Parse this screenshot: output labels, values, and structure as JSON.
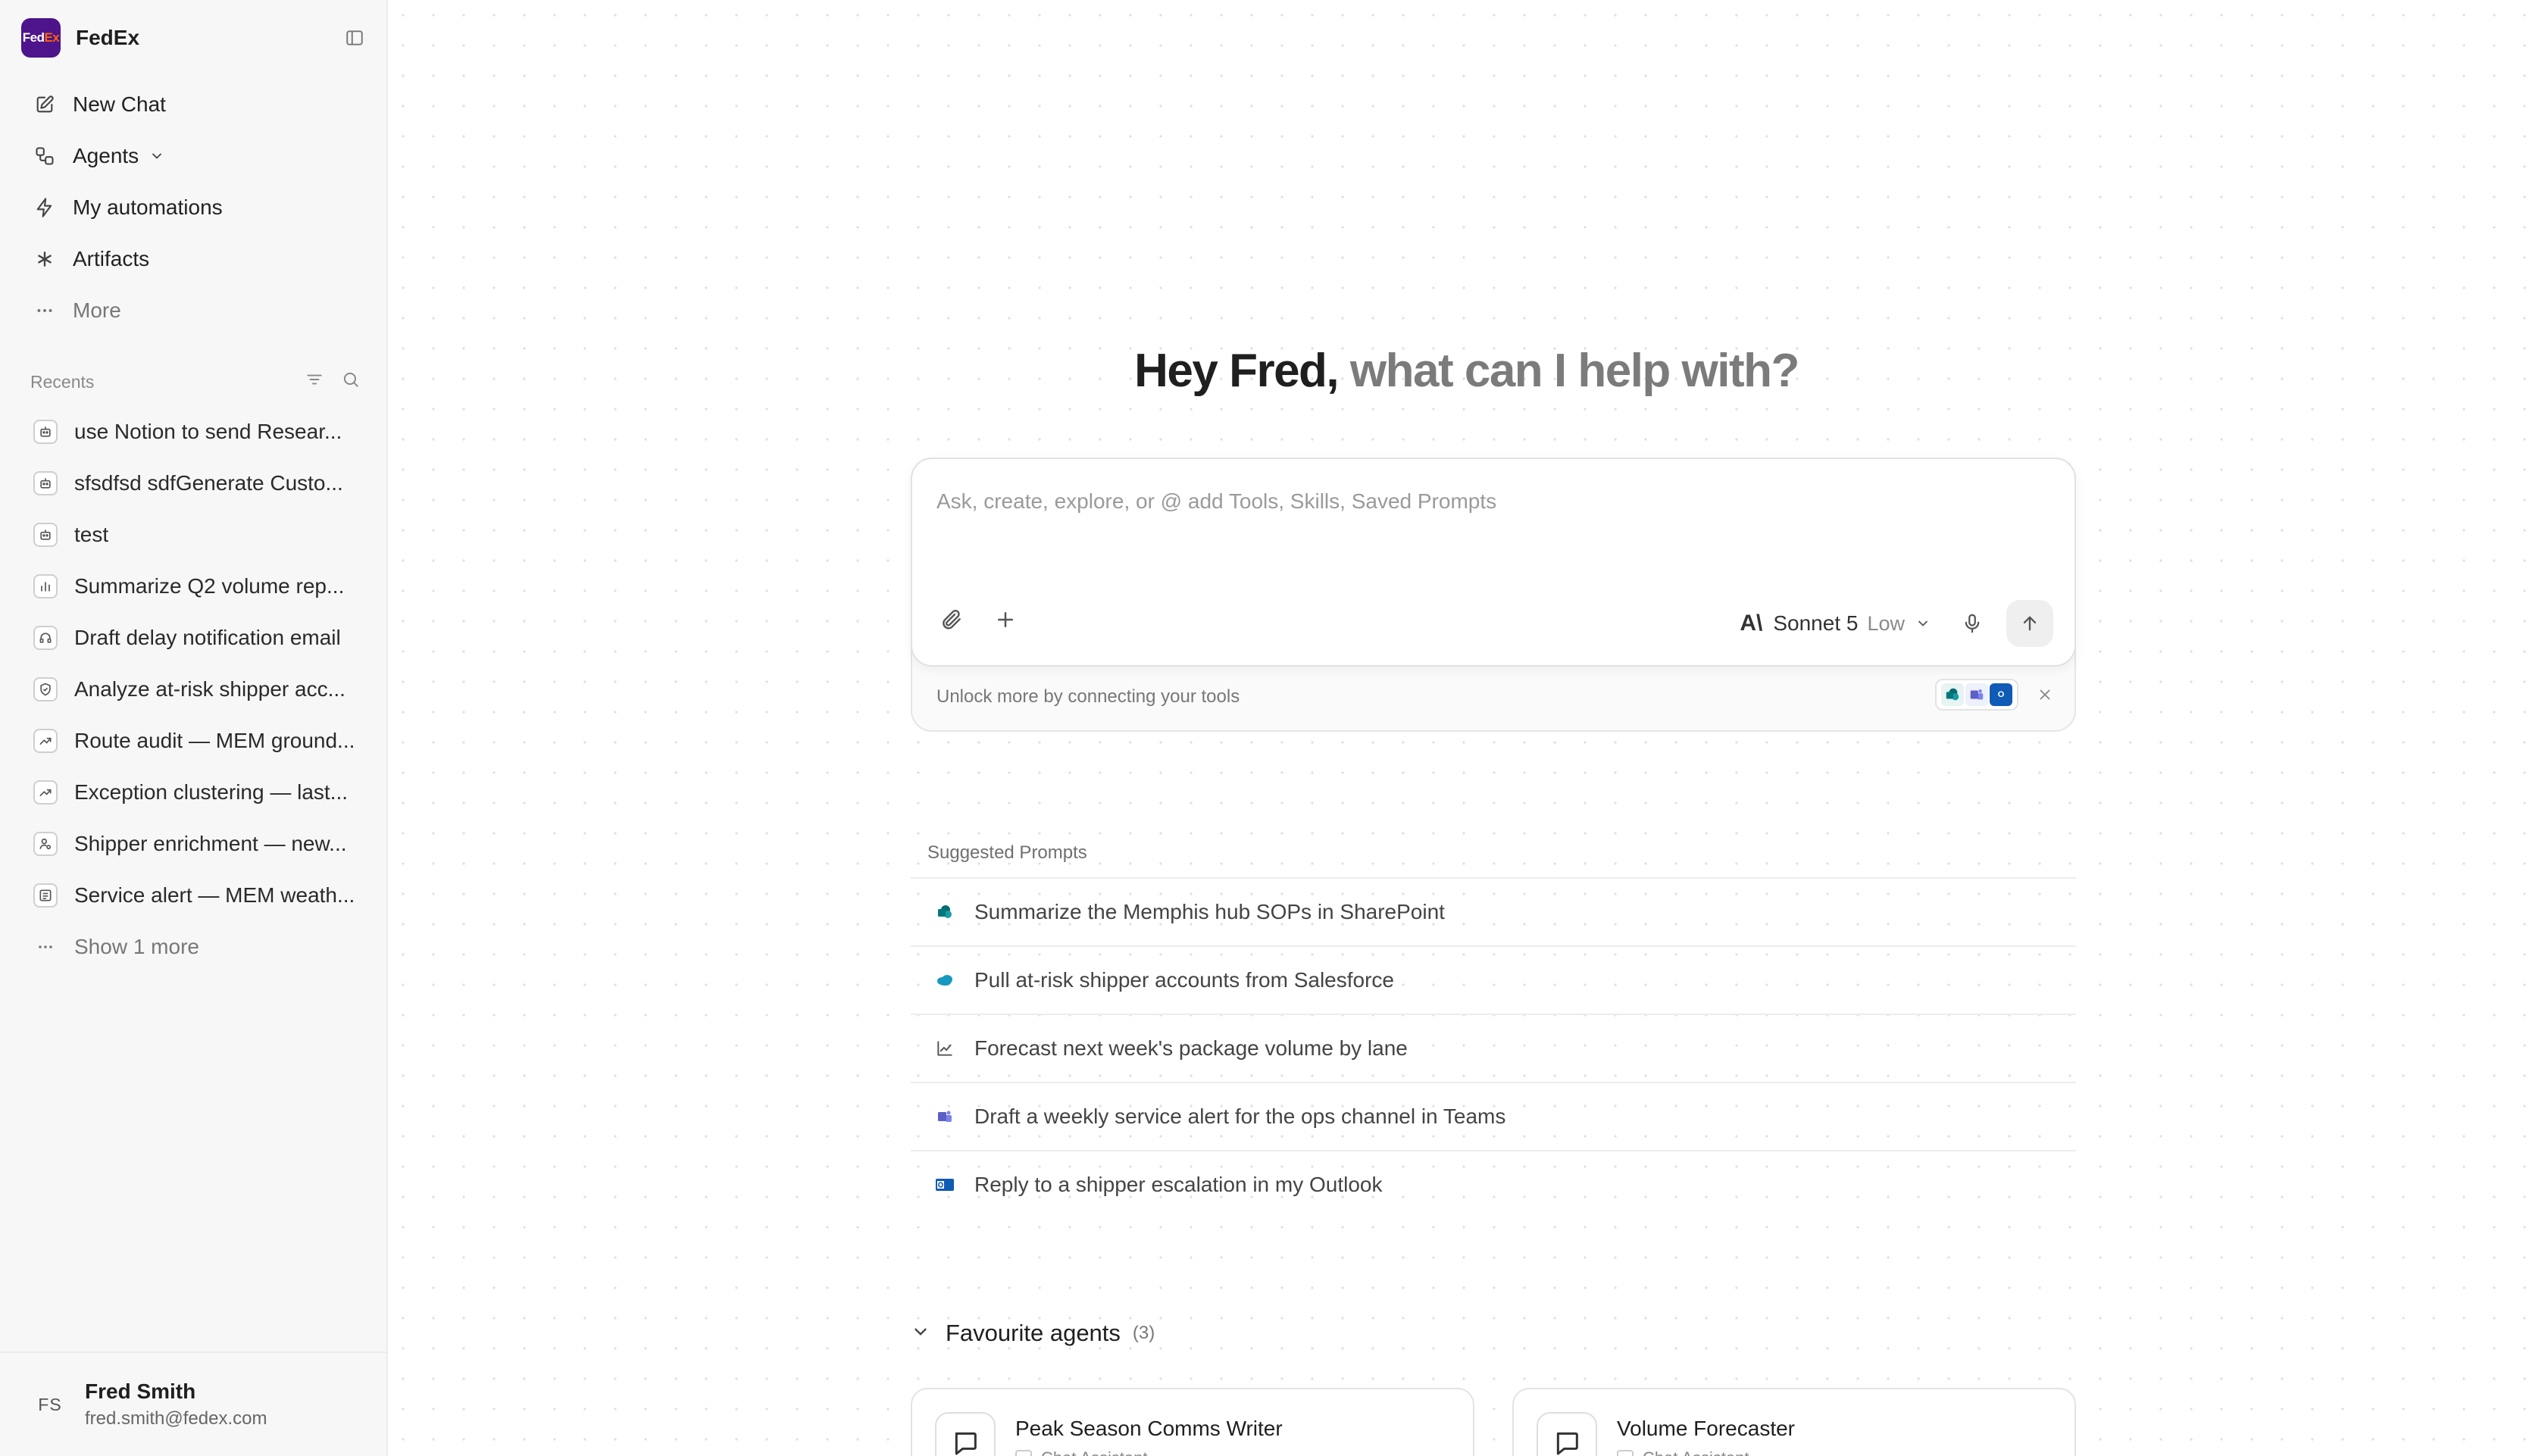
{
  "brand": {
    "logo_text_a": "Fed",
    "logo_text_b": "Ex",
    "name": "FedEx"
  },
  "nav": {
    "new_chat": "New Chat",
    "agents": "Agents",
    "automations": "My automations",
    "artifacts": "Artifacts",
    "more": "More"
  },
  "recents": {
    "title": "Recents",
    "items": [
      {
        "label": "use Notion to send Resear...",
        "icon": "bot-icon"
      },
      {
        "label": "sfsdfsd sdfGenerate Custo...",
        "icon": "bot-icon"
      },
      {
        "label": "test",
        "icon": "bot-icon"
      },
      {
        "label": "Summarize Q2 volume rep...",
        "icon": "bar-chart-icon"
      },
      {
        "label": "Draft delay notification email",
        "icon": "headset-icon"
      },
      {
        "label": "Analyze at-risk shipper acc...",
        "icon": "badge-icon"
      },
      {
        "label": "Route audit — MEM ground...",
        "icon": "trend-icon"
      },
      {
        "label": "Exception clustering — last...",
        "icon": "trend-icon"
      },
      {
        "label": "Shipper enrichment — new...",
        "icon": "user-icon"
      },
      {
        "label": "Service alert — MEM weath...",
        "icon": "newspaper-icon"
      }
    ],
    "show_more": "Show 1 more"
  },
  "user": {
    "initials": "FS",
    "name": "Fred Smith",
    "email": "fred.smith@fedex.com"
  },
  "greeting": {
    "highlight": "Hey Fred,",
    "rest": " what can I help with?"
  },
  "composer": {
    "placeholder": "Ask, create, explore, or @ add Tools, Skills, Saved Prompts",
    "model_logo": "A\\",
    "model": "Sonnet 5",
    "effort": "Low",
    "connect_text": "Unlock more by connecting your tools",
    "outlook_glyph": "O"
  },
  "suggested": {
    "title": "Suggested Prompts",
    "items": [
      {
        "label": "Summarize the Memphis hub SOPs in SharePoint",
        "icon": "sharepoint-icon"
      },
      {
        "label": "Pull at-risk shipper accounts from Salesforce",
        "icon": "salesforce-icon"
      },
      {
        "label": "Forecast next week's package volume by lane",
        "icon": "line-chart-icon"
      },
      {
        "label": "Draft a weekly service alert for the ops channel in Teams",
        "icon": "teams-icon"
      },
      {
        "label": "Reply to a shipper escalation in my Outlook",
        "icon": "outlook-icon"
      }
    ]
  },
  "favourites": {
    "title": "Favourite agents",
    "count": "(3)",
    "agents": [
      {
        "name": "Peak Season Comms Writer",
        "sub": "Chat Assistant"
      },
      {
        "name": "Volume Forecaster",
        "sub": "Chat Assistant"
      }
    ]
  },
  "colors": {
    "brand_purple": "#4d148c",
    "brand_orange": "#ff6200",
    "teams": "#5b5fc7",
    "outlook": "#0f5bb5",
    "sharepoint": "#038387",
    "salesforce": "#1798c1"
  }
}
